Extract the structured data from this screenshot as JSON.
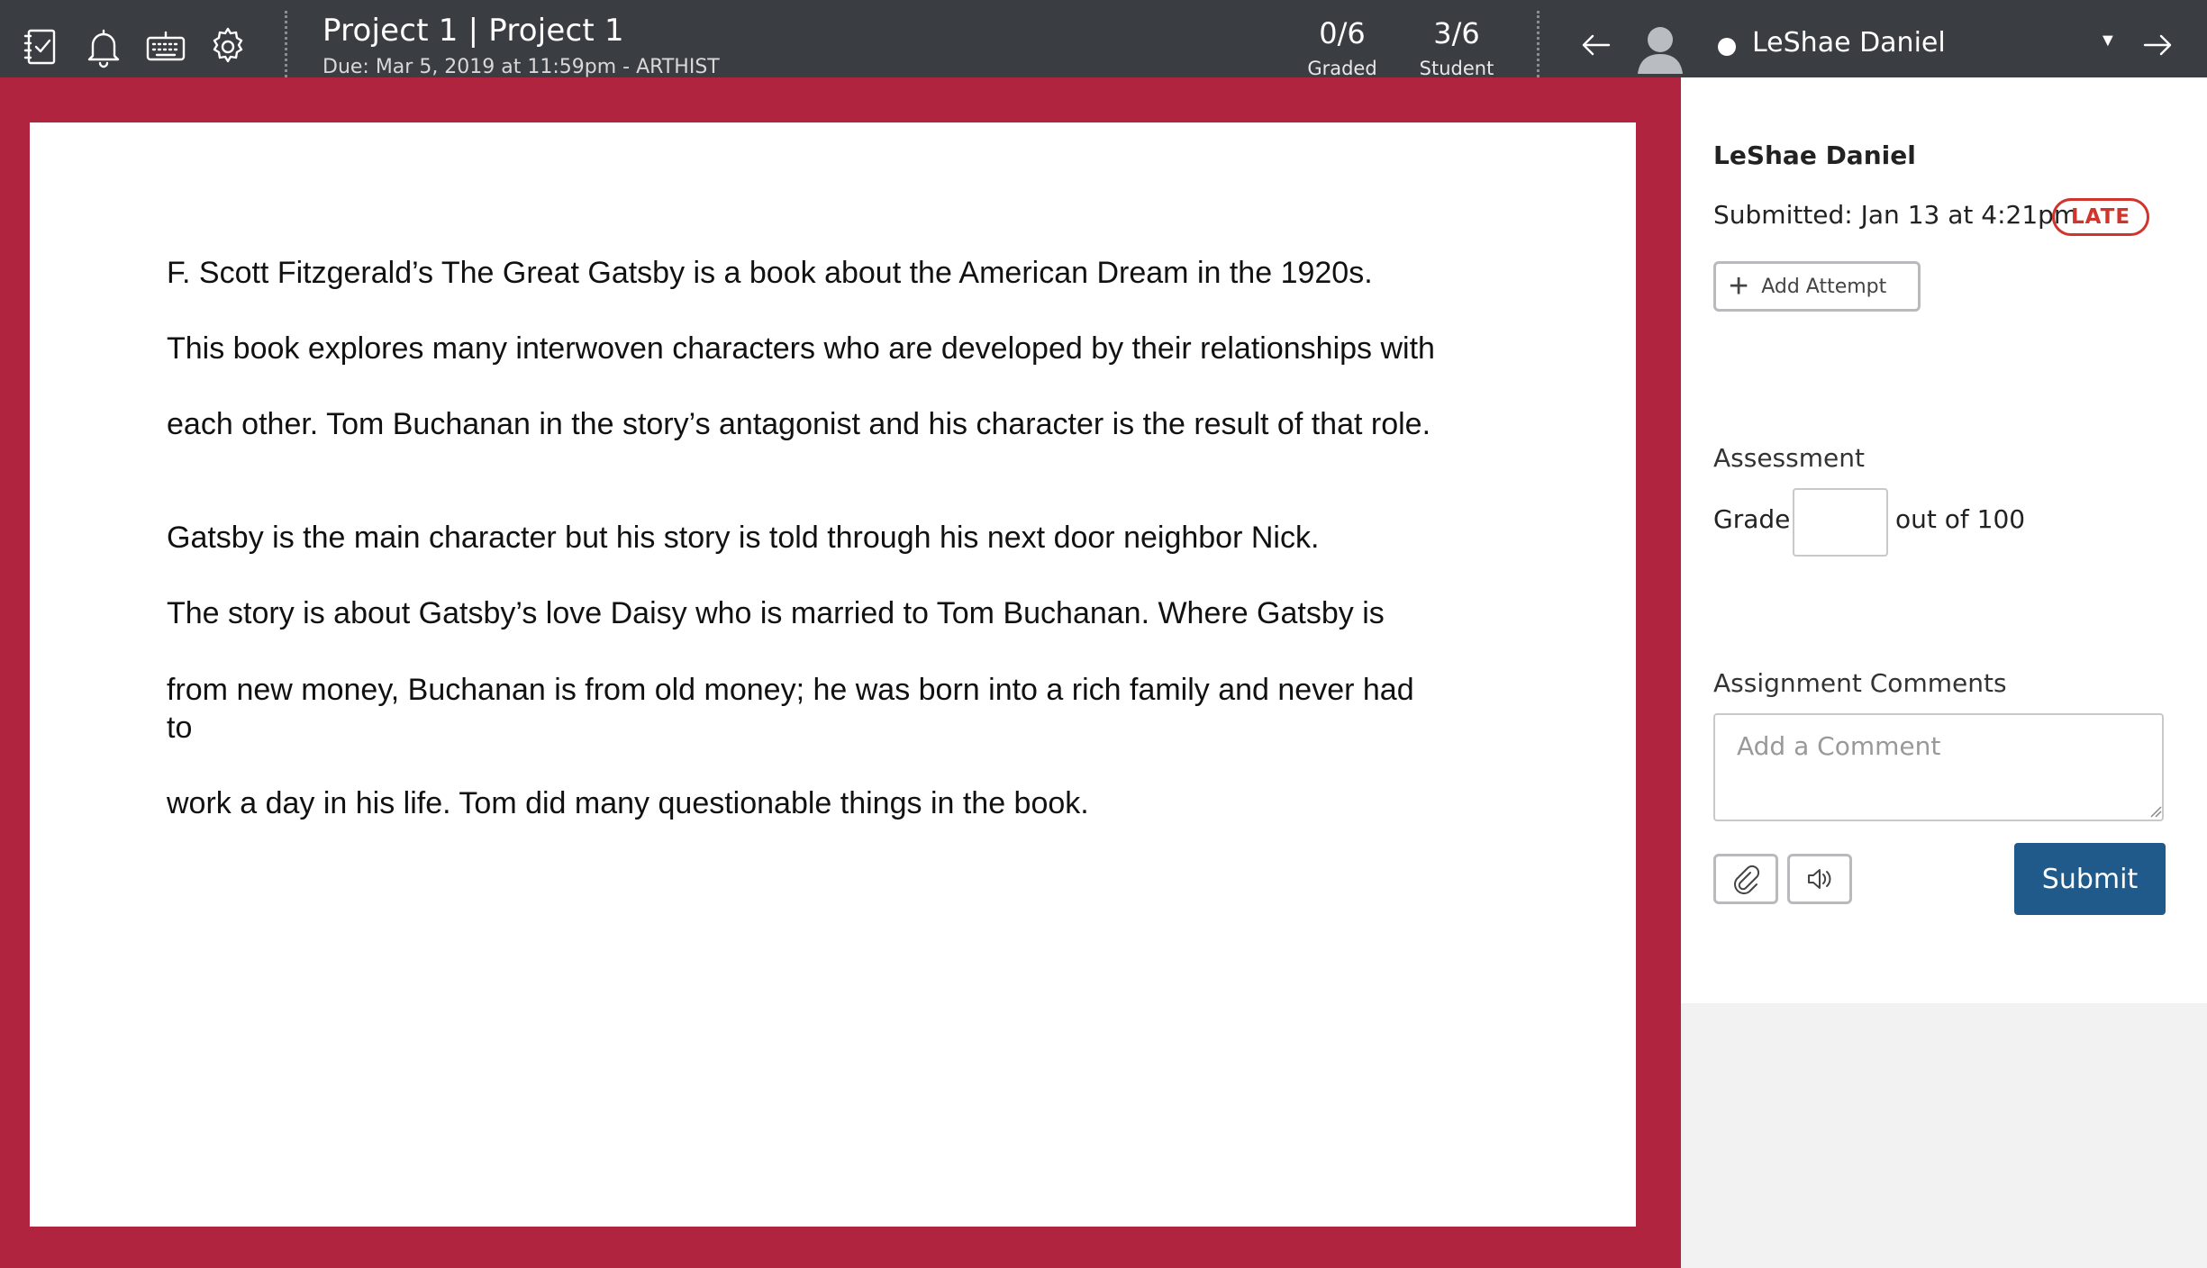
{
  "toolbar": {
    "icons": [
      "gradebook-icon",
      "bell-icon",
      "keyboard-icon",
      "gear-icon"
    ],
    "title": "Project 1 | Project 1",
    "due": "Due: Mar 5, 2019 at 11:59pm - ARTHIST",
    "graded": {
      "value": "0/6",
      "label": "Graded"
    },
    "student": {
      "value": "3/6",
      "label": "Student"
    },
    "student_name": "LeShae Daniel"
  },
  "document": {
    "lines": [
      "F. Scott Fitzgerald’s The Great Gatsby is a book about the American Dream in the 1920s.",
      "This book explores many interwoven characters who are developed by their relationships with",
      "each other. Tom Buchanan in the story’s antagonist and his character is the result of that role.",
      "Gatsby is the main character but his story is told through his next door neighbor Nick.",
      "The story is about Gatsby’s love Daisy who is married to Tom Buchanan. Where Gatsby is",
      "from new money, Buchanan is from old money; he was born into a rich family and never had",
      "to",
      "work a day in his life. Tom did many questionable things in the book."
    ]
  },
  "panel": {
    "name": "LeShae Daniel",
    "submitted": "Submitted: Jan 13 at 4:21pm",
    "late_badge": "LATE",
    "add_attempt_label": "Add Attempt",
    "assessment_label": "Assessment",
    "grade_label": "Grade",
    "grade_value": "",
    "out_of": "out of 100",
    "comments_label": "Assignment Comments",
    "comment_placeholder": "Add a Comment",
    "submit_label": "Submit"
  },
  "colors": {
    "toolbar": "#3a3d42",
    "viewer_border": "#b0243f",
    "late": "#d0342c",
    "submit": "#1f5a8a"
  }
}
